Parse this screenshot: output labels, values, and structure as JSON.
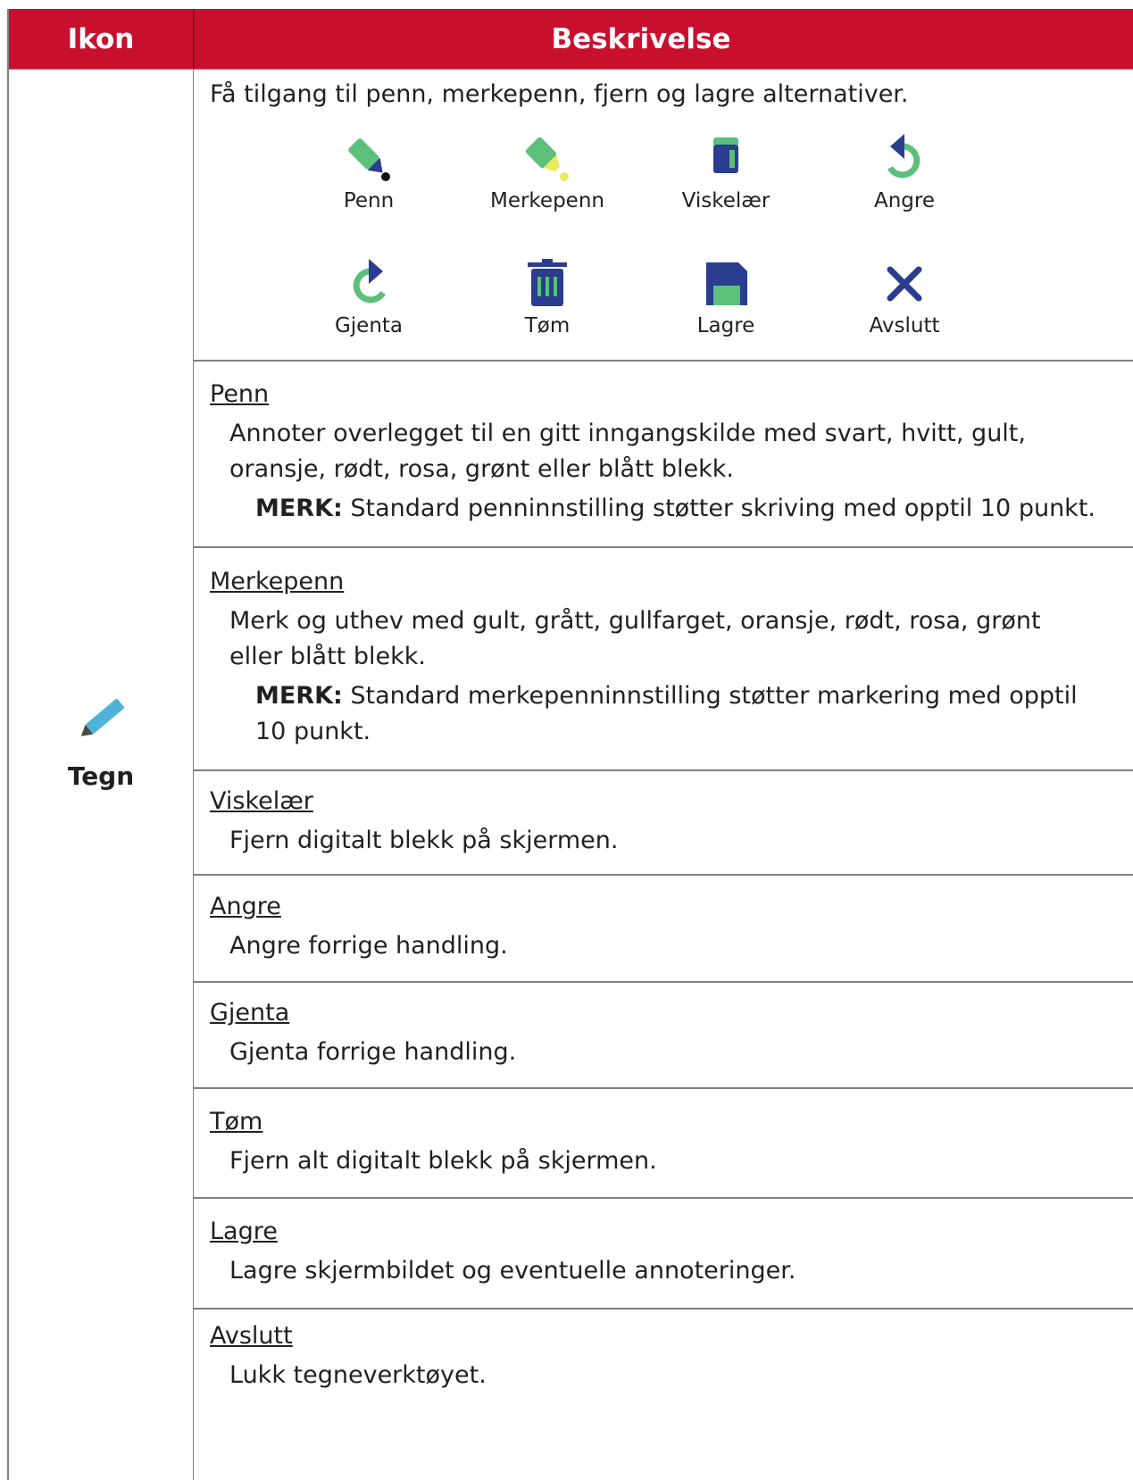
{
  "header": {
    "col_icon": "Ikon",
    "col_desc": "Beskrivelse"
  },
  "row": {
    "label": "Tegn",
    "icon": "pencil-icon"
  },
  "intro": "Få tilgang til penn, merkepenn, fjern og lagre alternativer.",
  "tools": [
    {
      "label": "Penn",
      "icon": "pen-icon"
    },
    {
      "label": "Merkepenn",
      "icon": "highlighter-icon"
    },
    {
      "label": "Viskelær",
      "icon": "eraser-icon"
    },
    {
      "label": "Angre",
      "icon": "undo-icon"
    },
    {
      "label": "Gjenta",
      "icon": "redo-icon"
    },
    {
      "label": "Tøm",
      "icon": "trash-icon"
    },
    {
      "label": "Lagre",
      "icon": "save-icon"
    },
    {
      "label": "Avslutt",
      "icon": "close-icon"
    }
  ],
  "sections": [
    {
      "title": "Penn",
      "desc1": "Annoter overlegget til en gitt inngangskilde med svart, hvitt, gult,",
      "desc2": "oransje, rødt, rosa, grønt eller blått blekk.",
      "note_label": "MERK:",
      "note": " Standard penninnstilling støtter skriving med opptil 10 punkt."
    },
    {
      "title": "Merkepenn",
      "desc1": "Merk og uthev med gult, grått, gullfarget, oransje, rødt, rosa, grønt",
      "desc2": "eller blått blekk.",
      "note_label": "MERK:",
      "note": " Standard merkepenninnstilling støtter markering med opptil",
      "note2": "10 punkt."
    },
    {
      "title": "Viskelær",
      "desc1": "Fjern digitalt blekk på skjermen."
    },
    {
      "title": "Angre",
      "desc1": "Angre forrige handling."
    },
    {
      "title": "Gjenta",
      "desc1": "Gjenta forrige handling."
    },
    {
      "title": "Tøm",
      "desc1": "Fjern alt digitalt blekk på skjermen."
    },
    {
      "title": "Lagre",
      "desc1": "Lagre skjermbildet og eventuelle annoteringer."
    },
    {
      "title": "Avslutt",
      "desc1": "Lukk tegneverktøyet."
    }
  ],
  "colors": {
    "header_bg": "#c8102e",
    "icon_green": "#5cbf7a",
    "icon_navy": "#2a3d8f",
    "pencil_blue": "#4fb3d9"
  }
}
